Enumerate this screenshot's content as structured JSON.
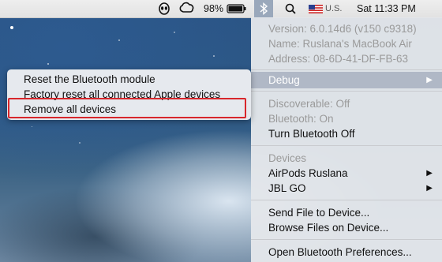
{
  "menubar": {
    "battery_percent": "98%",
    "battery_level": 0.98,
    "language": "U.S.",
    "clock": "Sat 11:33 PM",
    "icons": [
      "alien-face-icon",
      "creative-cloud-icon",
      "battery-icon",
      "bluetooth-icon",
      "search-icon",
      "us-flag-icon"
    ]
  },
  "bluetooth_menu": {
    "info": {
      "version": "Version: 6.0.14d6 (v150 c9318)",
      "name": "Name: Ruslana's MacBook Air",
      "address": "Address: 08-6D-41-DF-FB-63"
    },
    "debug_label": "Debug",
    "discoverable": "Discoverable: Off",
    "bluetooth_status": "Bluetooth: On",
    "turn_off": "Turn Bluetooth Off",
    "devices_header": "Devices",
    "devices": [
      "AirPods Ruslana",
      "JBL GO"
    ],
    "send_file": "Send File to Device...",
    "browse_files": "Browse Files on Device...",
    "open_prefs": "Open Bluetooth Preferences..."
  },
  "debug_submenu": {
    "items": [
      "Reset the Bluetooth module",
      "Factory reset all connected Apple devices",
      "Remove all devices"
    ]
  },
  "colors": {
    "highlight_border": "#d8262b",
    "menu_highlight": "#b0b8c6"
  }
}
